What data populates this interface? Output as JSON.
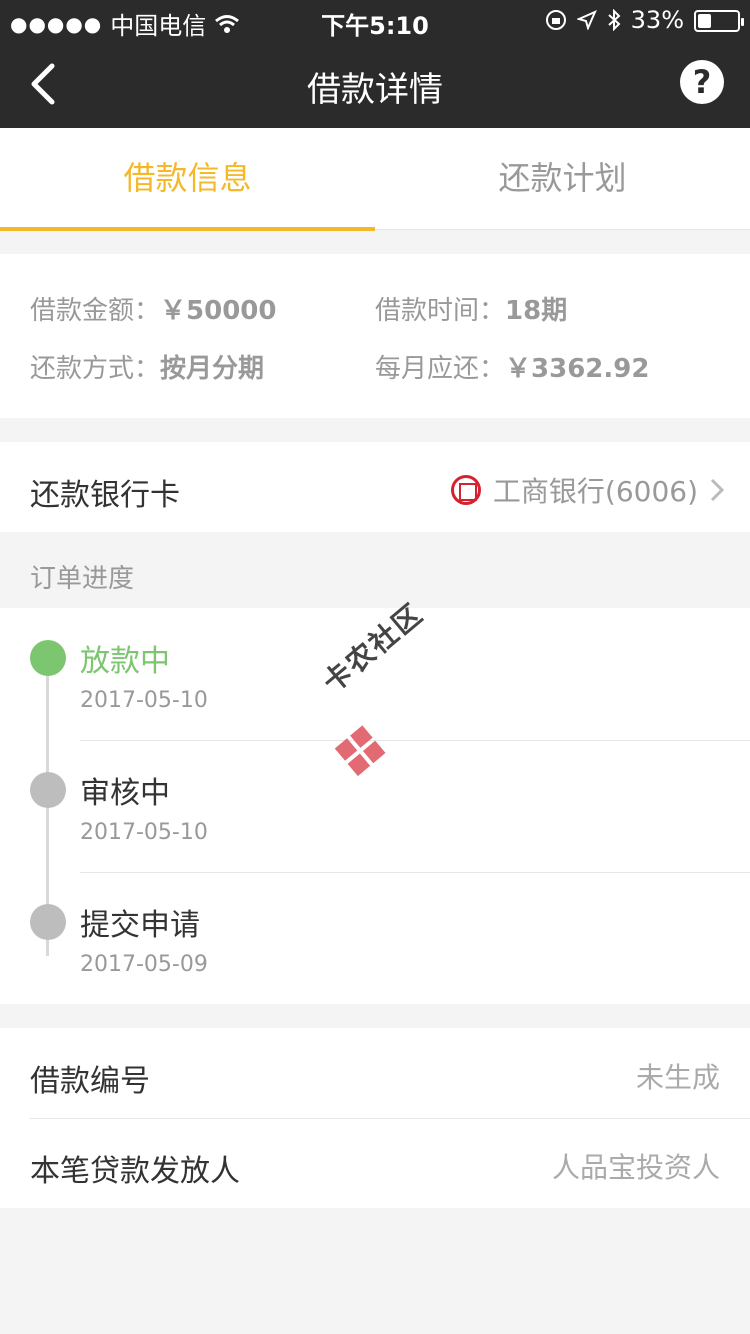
{
  "status": {
    "carrier": "中国电信",
    "time": "下午5:10",
    "battery": "33%",
    "battery_level": 0.33
  },
  "nav": {
    "title": "借款详情",
    "help_label": "?"
  },
  "tabs": [
    {
      "label": "借款信息",
      "active": true
    },
    {
      "label": "还款计划",
      "active": false
    }
  ],
  "loan_info": {
    "amount_label": "借款金额：",
    "amount_value": "￥50000",
    "term_label": "借款时间：",
    "term_value": "18期",
    "method_label": "还款方式：",
    "method_value": "按月分期",
    "monthly_label": "每月应还：",
    "monthly_value": "￥3362.92"
  },
  "bank": {
    "label": "还款银行卡",
    "value": "工商银行(6006)"
  },
  "progress": {
    "title": "订单进度",
    "steps": [
      {
        "name": "放款中",
        "date": "2017-05-10",
        "active": true
      },
      {
        "name": "审核中",
        "date": "2017-05-10",
        "active": false
      },
      {
        "name": "提交申请",
        "date": "2017-05-09",
        "active": false
      }
    ]
  },
  "meta": {
    "loan_no_label": "借款编号",
    "loan_no_value": "未生成",
    "lender_label": "本笔贷款发放人",
    "lender_value": "人品宝投资人"
  },
  "watermark": {
    "text": "卡农社区"
  },
  "colors": {
    "accent": "#f4b92b",
    "active_green": "#7bc66f",
    "topbar": "#2b2b2b"
  }
}
